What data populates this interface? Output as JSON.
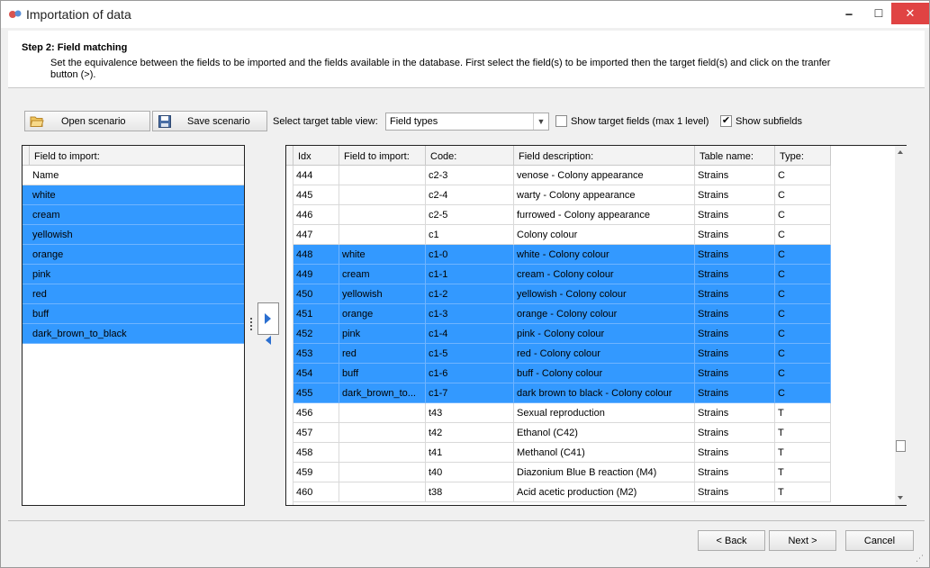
{
  "window": {
    "title": "Importation of data",
    "minimize_glyph": "🗕",
    "maximize_glyph": "☐",
    "close_glyph": "✕"
  },
  "header": {
    "step_title": "Step 2: Field matching",
    "description": "Set the equivalence between the fields to be imported and the fields available in the database. First select the field(s) to be imported then the target field(s) and click on the tranfer button (>)."
  },
  "toolbar": {
    "open_label": "Open scenario",
    "save_label": "Save scenario",
    "select_label": "Select target table view:",
    "select_value": "Field types",
    "show_target_label": "Show target fields (max 1 level)",
    "show_target_checked": false,
    "show_subfields_label": "Show subfields",
    "show_subfields_checked": true,
    "check_glyph": "✔"
  },
  "left_grid": {
    "header": "Field to import:",
    "rows": [
      {
        "label": "Name",
        "selected": false
      },
      {
        "label": "white",
        "selected": true
      },
      {
        "label": "cream",
        "selected": true
      },
      {
        "label": "yellowish",
        "selected": true
      },
      {
        "label": "orange",
        "selected": true
      },
      {
        "label": "pink",
        "selected": true
      },
      {
        "label": "red",
        "selected": true
      },
      {
        "label": "buff",
        "selected": true
      },
      {
        "label": "dark_brown_to_black",
        "selected": true
      }
    ]
  },
  "right_grid": {
    "columns": [
      "Idx",
      "Field to import:",
      "Code:",
      "Field description:",
      "Table name:",
      "Type:"
    ],
    "rows": [
      {
        "idx": "444",
        "field": "",
        "code": "c2-3",
        "desc": "venose - Colony appearance",
        "table": "Strains",
        "type": "C",
        "selected": false
      },
      {
        "idx": "445",
        "field": "",
        "code": "c2-4",
        "desc": "warty - Colony appearance",
        "table": "Strains",
        "type": "C",
        "selected": false
      },
      {
        "idx": "446",
        "field": "",
        "code": "c2-5",
        "desc": "furrowed - Colony appearance",
        "table": "Strains",
        "type": "C",
        "selected": false
      },
      {
        "idx": "447",
        "field": "",
        "code": "c1",
        "desc": "Colony colour",
        "table": "Strains",
        "type": "C",
        "selected": false
      },
      {
        "idx": "448",
        "field": "white",
        "code": "c1-0",
        "desc": "white - Colony colour",
        "table": "Strains",
        "type": "C",
        "selected": true
      },
      {
        "idx": "449",
        "field": "cream",
        "code": "c1-1",
        "desc": "cream - Colony colour",
        "table": "Strains",
        "type": "C",
        "selected": true
      },
      {
        "idx": "450",
        "field": "yellowish",
        "code": "c1-2",
        "desc": "yellowish - Colony colour",
        "table": "Strains",
        "type": "C",
        "selected": true
      },
      {
        "idx": "451",
        "field": "orange",
        "code": "c1-3",
        "desc": "orange - Colony colour",
        "table": "Strains",
        "type": "C",
        "selected": true
      },
      {
        "idx": "452",
        "field": "pink",
        "code": "c1-4",
        "desc": "pink - Colony colour",
        "table": "Strains",
        "type": "C",
        "selected": true
      },
      {
        "idx": "453",
        "field": "red",
        "code": "c1-5",
        "desc": "red - Colony colour",
        "table": "Strains",
        "type": "C",
        "selected": true
      },
      {
        "idx": "454",
        "field": "buff",
        "code": "c1-6",
        "desc": "buff - Colony colour",
        "table": "Strains",
        "type": "C",
        "selected": true
      },
      {
        "idx": "455",
        "field": "dark_brown_to...",
        "code": "c1-7",
        "desc": "dark brown to black - Colony colour",
        "table": "Strains",
        "type": "C",
        "selected": true
      },
      {
        "idx": "456",
        "field": "",
        "code": "t43",
        "desc": "Sexual reproduction",
        "table": "Strains",
        "type": "T",
        "selected": false
      },
      {
        "idx": "457",
        "field": "",
        "code": "t42",
        "desc": "Ethanol (C42)",
        "table": "Strains",
        "type": "T",
        "selected": false
      },
      {
        "idx": "458",
        "field": "",
        "code": "t41",
        "desc": "Methanol (C41)",
        "table": "Strains",
        "type": "T",
        "selected": false
      },
      {
        "idx": "459",
        "field": "",
        "code": "t40",
        "desc": "Diazonium Blue B reaction (M4)",
        "table": "Strains",
        "type": "T",
        "selected": false
      },
      {
        "idx": "460",
        "field": "",
        "code": "t38",
        "desc": "Acid acetic production (M2)",
        "table": "Strains",
        "type": "T",
        "selected": false
      }
    ]
  },
  "footer": {
    "back_label": "< Back",
    "next_label": "Next >",
    "cancel_label": "Cancel"
  },
  "colors": {
    "selection": "#3399ff",
    "close_button": "#e04343",
    "arrow": "#2b6fd0"
  }
}
